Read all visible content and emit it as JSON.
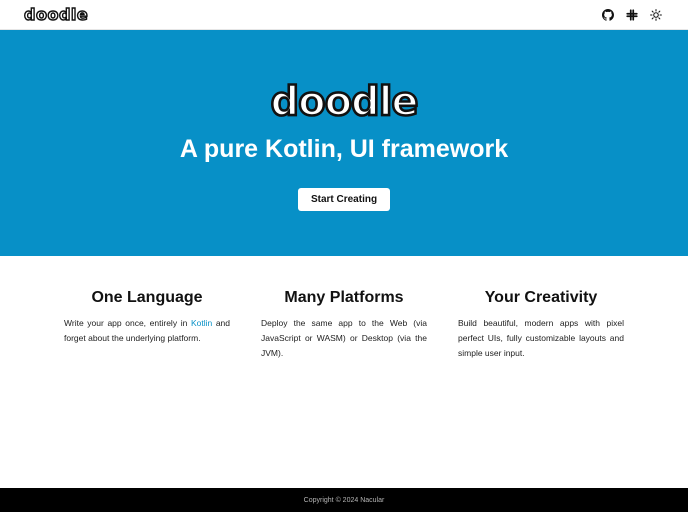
{
  "nav": {
    "logo_letters": [
      "d",
      "o",
      "o",
      "d",
      "l",
      "e"
    ],
    "icons": [
      "github-icon",
      "slack-icon",
      "theme-toggle-icon"
    ]
  },
  "hero": {
    "logo_letters": [
      "d",
      "o",
      "o",
      "d",
      "l",
      "e"
    ],
    "title": "A pure Kotlin, UI framework",
    "cta_label": "Start Creating",
    "background": "#0790c7"
  },
  "features": [
    {
      "title": "One Language",
      "text_before": "Write your app once, entirely in ",
      "link": "Kotlin",
      "text_after": " and forget about the underlying platform."
    },
    {
      "title": "Many Platforms",
      "text": "Deploy the same app to the Web (via JavaScript or WASM) or Desktop (via the JVM)."
    },
    {
      "title": "Your Creativity",
      "text": "Build beautiful, modern apps with pixel perfect UIs, fully customizable layouts and simple user input."
    }
  ],
  "footer": {
    "copyright": "Copyright © 2024 Nacular"
  }
}
